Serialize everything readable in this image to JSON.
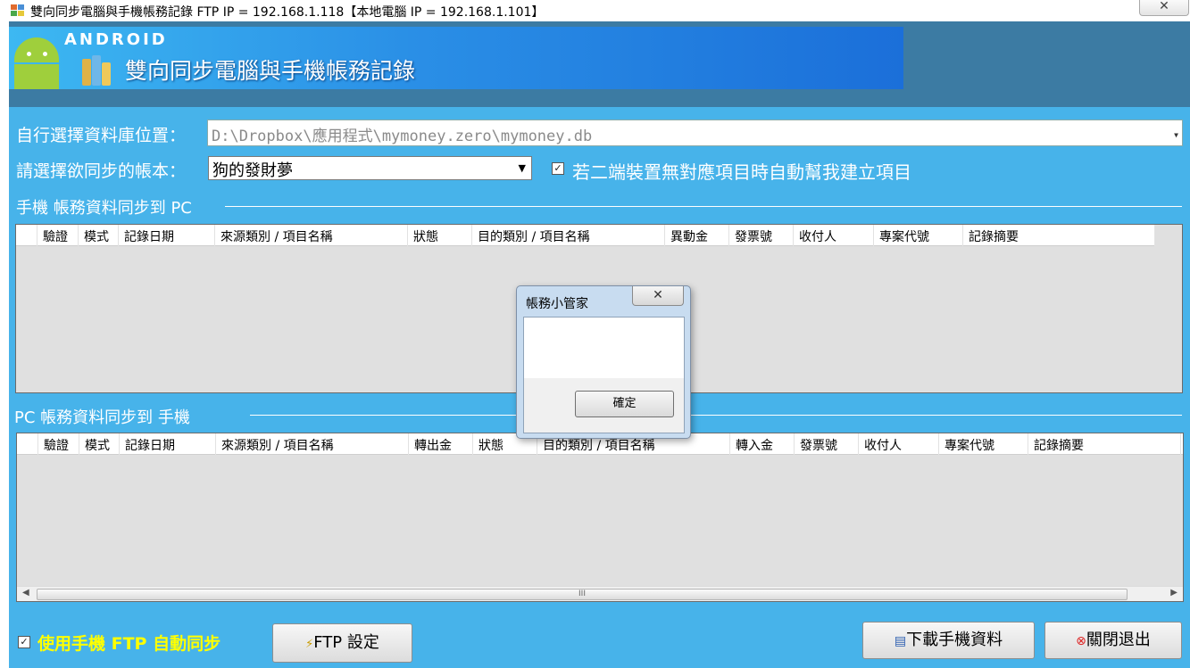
{
  "window": {
    "title": "雙向同步電腦與手機帳務記錄 FTP IP = 192.168.1.118【本地電腦 IP = 192.168.1.101】",
    "close_glyph": "✕"
  },
  "banner": {
    "android_word": "ANDROID",
    "title": "雙向同步電腦與手機帳務記錄"
  },
  "form": {
    "db_label": "自行選擇資料庫位置：",
    "db_path": "D:\\Dropbox\\應用程式\\mymoney.zero\\mymoney.db",
    "book_label": "請選擇欲同步的帳本：",
    "book_value": "狗的發財夢",
    "auto_create_label": "若二端裝置無對應項目時自動幫我建立項目",
    "auto_create_checked": true
  },
  "phone_to_pc": {
    "heading": "手機 帳務資料同步到 PC",
    "columns": [
      "驗證",
      "模式",
      "記錄日期",
      "來源類別 / 項目名稱",
      "狀態",
      "目的類別 / 項目名稱",
      "異動金",
      "發票號",
      "收付人",
      "專案代號",
      "記錄摘要"
    ]
  },
  "pc_to_phone": {
    "heading": "PC 帳務資料同步到 手機",
    "columns": [
      "驗證",
      "模式",
      "記錄日期",
      "來源類別 / 項目名稱",
      "轉出金",
      "狀態",
      "目的類別 / 項目名稱",
      "轉入金",
      "發票號",
      "收付人",
      "專案代號",
      "記錄摘要"
    ],
    "scroll_grip": "III"
  },
  "footer": {
    "use_ftp_label": "使用手機 FTP 自動同步",
    "use_ftp_checked": true,
    "ftp_button": "FTP 設定",
    "download_button": "下載手機資料",
    "exit_button": "關閉退出"
  },
  "dialog": {
    "title": "帳務小管家",
    "message": "",
    "ok_button": "確定",
    "close_glyph": "✕"
  },
  "colors": {
    "client_bg": "#47b3ea",
    "banner_strip": "#3c7ba3",
    "footer_label": "#ffff00"
  }
}
